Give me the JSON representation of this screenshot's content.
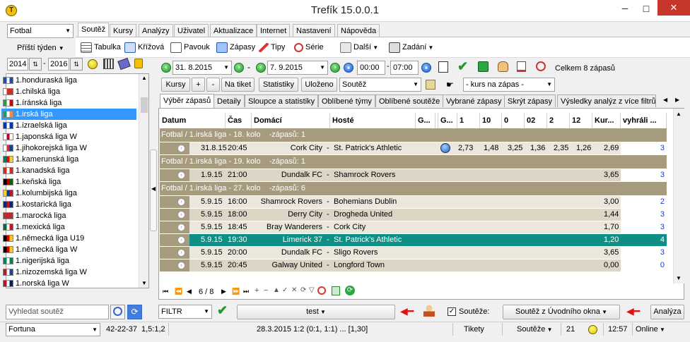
{
  "window": {
    "title": "Trefík 15.0.0.1",
    "min": "─",
    "max": "□",
    "close": "✕"
  },
  "left": {
    "sport": "Fotbal",
    "week": "Příští týden",
    "year_from": "2014",
    "year_to": "2016",
    "leagues": [
      {
        "name": "1.honduraská liga",
        "flag": [
          "#1e4fa3",
          "#ffffff",
          "#1e4fa3"
        ]
      },
      {
        "name": "1.chilská liga",
        "flag": [
          "#ffffff",
          "#d52b1e",
          "#d52b1e"
        ]
      },
      {
        "name": "1.íránská liga",
        "flag": [
          "#239f40",
          "#ffffff",
          "#da0000"
        ]
      },
      {
        "name": "1.irská liga",
        "flag": [
          "#169b62",
          "#ffffff",
          "#ff883e"
        ],
        "selected": true
      },
      {
        "name": "1.izraelská liga",
        "flag": [
          "#0038b8",
          "#ffffff",
          "#0038b8"
        ]
      },
      {
        "name": "1.japonská liga W",
        "flag": [
          "#ffffff",
          "#bc002d",
          "#ffffff"
        ]
      },
      {
        "name": "1.jihokorejská liga W",
        "flag": [
          "#ffffff",
          "#cd2e3a",
          "#0047a0"
        ]
      },
      {
        "name": "1.kamerunská liga",
        "flag": [
          "#007a5e",
          "#ce1126",
          "#fcd116"
        ]
      },
      {
        "name": "1.kanadská liga",
        "flag": [
          "#d52b1e",
          "#ffffff",
          "#d52b1e"
        ]
      },
      {
        "name": "1.keňská liga",
        "flag": [
          "#000000",
          "#bb0000",
          "#006600"
        ]
      },
      {
        "name": "1.kolumbijská liga",
        "flag": [
          "#fcd116",
          "#003893",
          "#ce1126"
        ]
      },
      {
        "name": "1.kostarická liga",
        "flag": [
          "#002b7f",
          "#ce1126",
          "#002b7f"
        ]
      },
      {
        "name": "1.marocká liga",
        "flag": [
          "#c1272d",
          "#c1272d",
          "#c1272d"
        ]
      },
      {
        "name": "1.mexická liga",
        "flag": [
          "#006847",
          "#ffffff",
          "#ce1126"
        ]
      },
      {
        "name": "1.německá liga U19",
        "flag": [
          "#000000",
          "#dd0000",
          "#ffce00"
        ]
      },
      {
        "name": "1.německá liga W",
        "flag": [
          "#000000",
          "#dd0000",
          "#ffce00"
        ]
      },
      {
        "name": "1.nigerijská liga",
        "flag": [
          "#008751",
          "#ffffff",
          "#008751"
        ]
      },
      {
        "name": "1.nizozemská liga W",
        "flag": [
          "#ae1c28",
          "#ffffff",
          "#21468b"
        ]
      },
      {
        "name": "1.norská liga W",
        "flag": [
          "#ba0c2f",
          "#ffffff",
          "#00205b"
        ]
      }
    ],
    "search_placeholder": "Vyhledat soutěž"
  },
  "tabs": [
    "Soutěž",
    "Kursy",
    "Analýzy",
    "Uživatel",
    "Aktualizace",
    "Internet",
    "Nastavení",
    "Nápověda"
  ],
  "toolbar": [
    "Tabulka",
    "Křížová",
    "Pavouk",
    "Zápasy",
    "Tipy",
    "Série",
    "Další",
    "Zadání"
  ],
  "filter": {
    "date_from": "31. 8.2015",
    "date_to": "7. 9.2015",
    "time_from": "00:00",
    "time_to": "07:00",
    "total": "Celkem 8 zápasů"
  },
  "buttons": {
    "kursy": "Kursy",
    "plus": "+",
    "minus": "-",
    "na_tiket": "Na tiket",
    "statistiky": "Statistiky",
    "ulozeno": "Uloženo",
    "soutez": "Soutěž",
    "kurs_na_zapas": "- kurs na zápas -"
  },
  "grid_tabs": [
    "Výběr zápasů",
    "Detaily",
    "Sloupce a statistiky",
    "Oblíbené týmy",
    "Oblíbené soutěže",
    "Vybrané zápasy",
    "Skrýt zápasy",
    "Výsledky analýz z více filtrů"
  ],
  "columns": [
    "Datum",
    "Čas",
    "Domácí",
    "Hosté",
    "G...",
    "",
    "G...",
    "1",
    "10",
    "0",
    "02",
    "2",
    "12",
    "Kur...",
    "vyhráli ..."
  ],
  "groups": [
    {
      "label": "Fotbal / 1.irská liga - 18. kolo",
      "count": "-zápasů: 1",
      "rows": [
        {
          "date": "31.8.15",
          "time": "20:45",
          "home": "Cork City",
          "sep": "-",
          "away": "St. Patrick's Athletic",
          "o1": "2,73",
          "o10": "1,48",
          "o0": "3,25",
          "o02": "1,36",
          "o2": "2,35",
          "o12": "1,26",
          "kur": "2,69",
          "won": "3",
          "icon": true
        }
      ]
    },
    {
      "label": "Fotbal / 1.irská liga - 19. kolo",
      "count": "-zápasů: 1",
      "rows": [
        {
          "date": "1.9.15",
          "time": "21:00",
          "home": "Dundalk FC",
          "sep": "-",
          "away": "Shamrock Rovers",
          "kur": "3,65",
          "won": "3"
        }
      ]
    },
    {
      "label": "Fotbal / 1.irská liga - 27. kolo",
      "count": "-zápasů: 6",
      "rows": [
        {
          "date": "5.9.15",
          "time": "16:00",
          "home": "Shamrock Rovers",
          "sep": "-",
          "away": "Bohemians Dublin",
          "kur": "3,00",
          "won": "2"
        },
        {
          "date": "5.9.15",
          "time": "18:00",
          "home": "Derry City",
          "sep": "-",
          "away": "Drogheda United",
          "kur": "1,44",
          "won": "3"
        },
        {
          "date": "5.9.15",
          "time": "18:45",
          "home": "Bray Wanderers",
          "sep": "-",
          "away": "Cork City",
          "kur": "1,70",
          "won": "3"
        },
        {
          "date": "5.9.15",
          "time": "19:30",
          "home": "Limerick 37",
          "sep": "-",
          "away": "St. Patrick's Athletic",
          "kur": "1,20",
          "won": "4",
          "selected": true
        },
        {
          "date": "5.9.15",
          "time": "20:00",
          "home": "Dundalk FC",
          "sep": "-",
          "away": "Sligo Rovers",
          "kur": "3,65",
          "won": "3"
        },
        {
          "date": "5.9.15",
          "time": "20:45",
          "home": "Galway United",
          "sep": "-",
          "away": "Longford Town",
          "kur": "0,00",
          "won": "0"
        }
      ]
    }
  ],
  "pager": {
    "pos": "6 / 8"
  },
  "bottom": {
    "filtr": "FILTR",
    "test": "test",
    "souteze_label": "Soutěže:",
    "souteze_value": "Soutěž z Úvodního okna",
    "analyza": "Analýza"
  },
  "status": {
    "bookmaker": "Fortuna",
    "record": "42-22-37",
    "ratio": "1,5:1,2",
    "last_match": "28.3.2015 1:2 (0:1, 1:1) ... [1,30]",
    "tikety": "Tikety",
    "souteze": "Soutěže",
    "count": "21",
    "clock": "12:57",
    "online": "Online"
  },
  "colors": {
    "tan": "#a79b7f",
    "selected_row": "#0e8f86",
    "row_light": "#ece7dc",
    "row_dark": "#ddd6c6",
    "accent_blue": "#3399ff"
  }
}
